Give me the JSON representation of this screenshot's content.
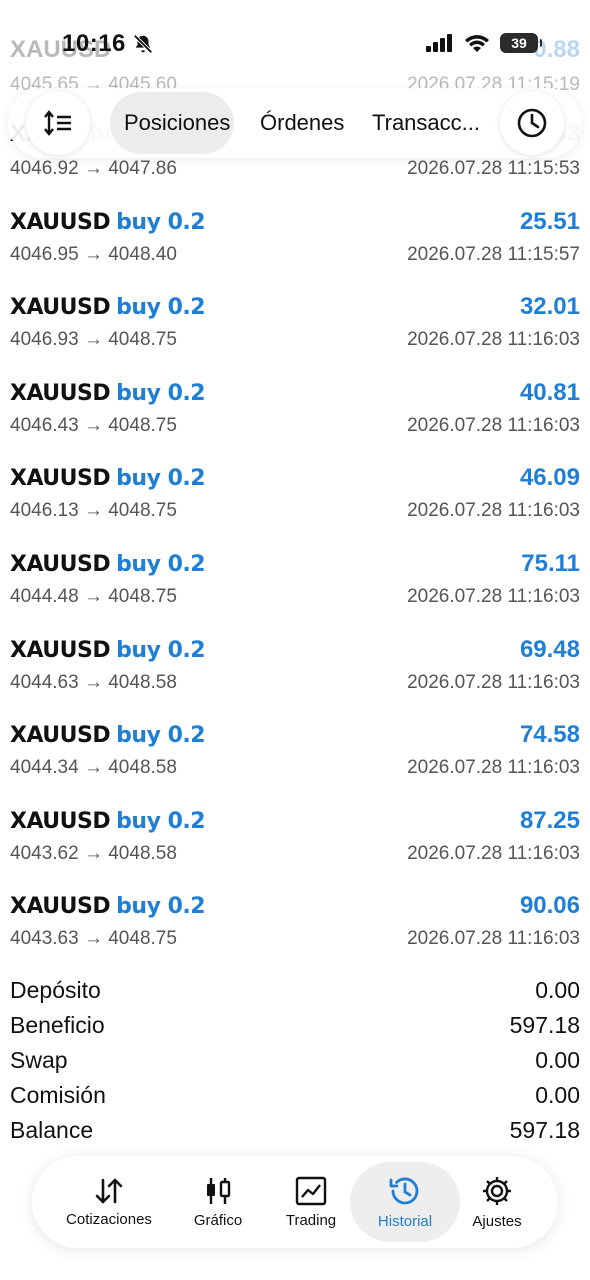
{
  "status_bar": {
    "time": "10:16",
    "battery": "39"
  },
  "ghost_rows": [
    {
      "symbol": "XAUUSD",
      "side": "buy 0.2",
      "profit": "0.88",
      "prices": "4045.65 → 4045.60",
      "time": "2026.07.28 11:15:19"
    },
    {
      "symbol": "XA",
      "side": "bu",
      "profit": "53",
      "prices": "",
      "time": ""
    }
  ],
  "tabs": {
    "positions": "Posiciones",
    "orders": "Órdenes",
    "transactions": "Transacc..."
  },
  "trades": [
    {
      "symbol": "",
      "side": "",
      "profit": "",
      "prices": "4046.92 → 4047.86",
      "time": "2026.07.28 11:15:53"
    },
    {
      "symbol": "XAUUSD",
      "side": "buy 0.2",
      "profit": "25.51",
      "prices": "4046.95 → 4048.40",
      "time": "2026.07.28 11:15:57"
    },
    {
      "symbol": "XAUUSD",
      "side": "buy 0.2",
      "profit": "32.01",
      "prices": "4046.93 → 4048.75",
      "time": "2026.07.28 11:16:03"
    },
    {
      "symbol": "XAUUSD",
      "side": "buy 0.2",
      "profit": "40.81",
      "prices": "4046.43 → 4048.75",
      "time": "2026.07.28 11:16:03"
    },
    {
      "symbol": "XAUUSD",
      "side": "buy 0.2",
      "profit": "46.09",
      "prices": "4046.13 → 4048.75",
      "time": "2026.07.28 11:16:03"
    },
    {
      "symbol": "XAUUSD",
      "side": "buy 0.2",
      "profit": "75.11",
      "prices": "4044.48 → 4048.75",
      "time": "2026.07.28 11:16:03"
    },
    {
      "symbol": "XAUUSD",
      "side": "buy 0.2",
      "profit": "69.48",
      "prices": "4044.63 → 4048.58",
      "time": "2026.07.28 11:16:03"
    },
    {
      "symbol": "XAUUSD",
      "side": "buy 0.2",
      "profit": "74.58",
      "prices": "4044.34 → 4048.58",
      "time": "2026.07.28 11:16:03"
    },
    {
      "symbol": "XAUUSD",
      "side": "buy 0.2",
      "profit": "87.25",
      "prices": "4043.62 → 4048.58",
      "time": "2026.07.28 11:16:03"
    },
    {
      "symbol": "XAUUSD",
      "side": "buy 0.2",
      "profit": "90.06",
      "prices": "4043.63 → 4048.75",
      "time": "2026.07.28 11:16:03"
    }
  ],
  "summary": [
    {
      "label": "Depósito",
      "value": "0.00"
    },
    {
      "label": "Beneficio",
      "value": "597.18"
    },
    {
      "label": "Swap",
      "value": "0.00"
    },
    {
      "label": "Comisión",
      "value": "0.00"
    },
    {
      "label": "Balance",
      "value": "597.18"
    }
  ],
  "nav": {
    "quotes": "Cotizaciones",
    "chart": "Gráfico",
    "trading": "Trading",
    "history": "Historial",
    "settings": "Ajustes"
  },
  "colors": {
    "accent": "#1f7fd6",
    "text": "#111111",
    "muted": "#555555"
  }
}
